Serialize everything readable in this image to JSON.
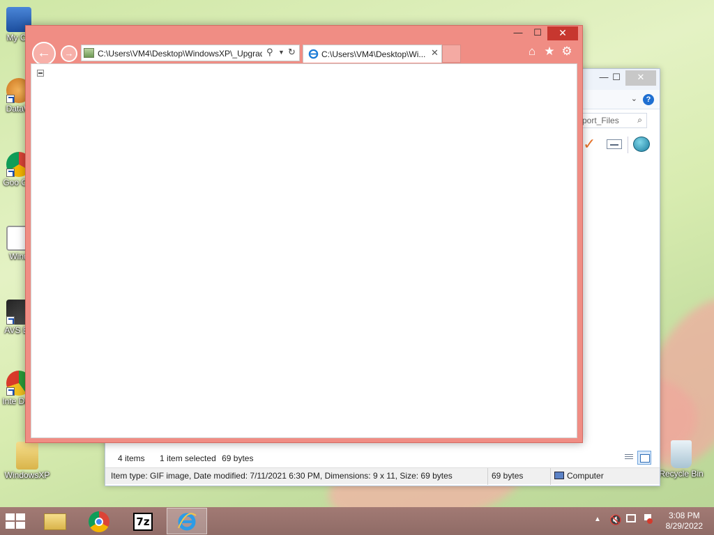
{
  "desktop": {
    "icons": [
      {
        "label": "My Co"
      },
      {
        "label": "DataW"
      },
      {
        "label": "Goo Chr"
      },
      {
        "label": "Wind"
      },
      {
        "label": "AVS Ed"
      },
      {
        "label": "Inte Dow"
      },
      {
        "label": "WindowsXP"
      },
      {
        "label": "Recycle Bin"
      }
    ]
  },
  "explorer": {
    "search_placeholder": "port_Files",
    "status": {
      "items": "4 items",
      "selected": "1 item selected",
      "size": "69 bytes"
    },
    "details_bar": {
      "info": "Item type: GIF image, Date modified: 7/11/2021 6:30 PM, Dimensions: 9 x 11, Size: 69 bytes",
      "size": "69 bytes",
      "location": "Computer"
    }
  },
  "ie": {
    "address": "C:\\Users\\VM4\\Desktop\\WindowsXP\\_Upgrad",
    "tab_title": "C:\\Users\\VM4\\Desktop\\Wi..."
  },
  "taskbar": {
    "time": "3:08 PM",
    "date": "8/29/2022"
  },
  "colors": {
    "ie_frame": "#f08d84",
    "ie_close": "#c7372f",
    "taskbar": "#9b7670",
    "accent_blue": "#1f6fd1"
  }
}
